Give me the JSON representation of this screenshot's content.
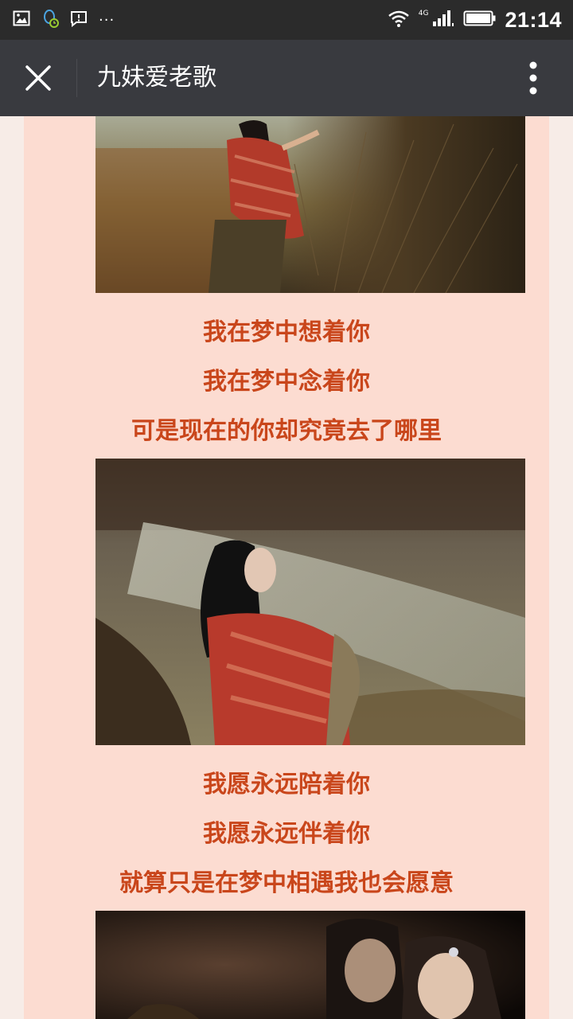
{
  "status_bar": {
    "time": "21:14",
    "network": "4G",
    "icons": [
      "image-icon",
      "qq-icon",
      "notification-icon",
      "more-dots-icon",
      "wifi-icon",
      "signal-icon",
      "battery-icon"
    ],
    "overflow": "···"
  },
  "app_bar": {
    "title": "九妹爱老歌",
    "close_icon": "close-icon",
    "more_icon": "more-vertical-icon"
  },
  "article": {
    "verse1": [
      "我在梦中想着你",
      "我在梦中念着你",
      "可是现在的你却究竟去了哪里"
    ],
    "verse2": [
      "我愿永远陪着你",
      "我愿永远伴着你",
      "就算只是在梦中相遇我也会愿意"
    ]
  },
  "colors": {
    "status_bar_bg": "#2b2b2b",
    "app_bar_bg": "#393a3f",
    "content_bg": "#fcdcd1",
    "lyric_text": "#c9461b"
  }
}
